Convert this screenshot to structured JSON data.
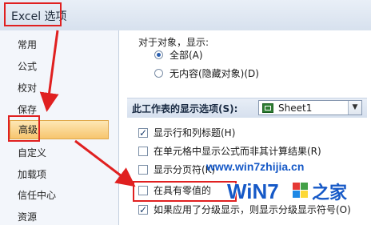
{
  "window": {
    "title": "Excel 选项"
  },
  "nav": {
    "items": [
      {
        "label": "常用",
        "selected": false
      },
      {
        "label": "公式",
        "selected": false
      },
      {
        "label": "校对",
        "selected": false
      },
      {
        "label": "保存",
        "selected": false
      },
      {
        "label": "高级",
        "selected": true
      },
      {
        "label": "自定义",
        "selected": false
      },
      {
        "label": "加载项",
        "selected": false
      },
      {
        "label": "信任中心",
        "selected": false
      },
      {
        "label": "资源",
        "selected": false
      }
    ]
  },
  "objects": {
    "heading": "对于对象，显示:",
    "options": [
      {
        "label": "全部(A)",
        "checked": true
      },
      {
        "label": "无内容(隐藏对象)(D)",
        "checked": false
      }
    ]
  },
  "sheet_section": {
    "label": "此工作表的显示选项(S):",
    "selected_sheet": "Sheet1",
    "sheet_icon": "excel-sheet-icon",
    "dropdown_icon": "chevron-down-icon"
  },
  "checks": [
    {
      "label": "显示行和列标题(H)",
      "checked": true
    },
    {
      "label": "在单元格中显示公式而非其计算结果(R)",
      "checked": false
    },
    {
      "label": "显示分页符(K)",
      "checked": false
    },
    {
      "label": "在具有零值的",
      "checked": false
    },
    {
      "label": "如果应用了分级显示，则显示分级显示符号(O)",
      "checked": true
    }
  ],
  "watermark": {
    "url": "www.win7zhijia.cn",
    "logo_text": "Win7之家"
  },
  "colors": {
    "annotation_red": "#e02020",
    "selected_nav": "#f7c56e",
    "watermark_blue": "#1659c7"
  }
}
